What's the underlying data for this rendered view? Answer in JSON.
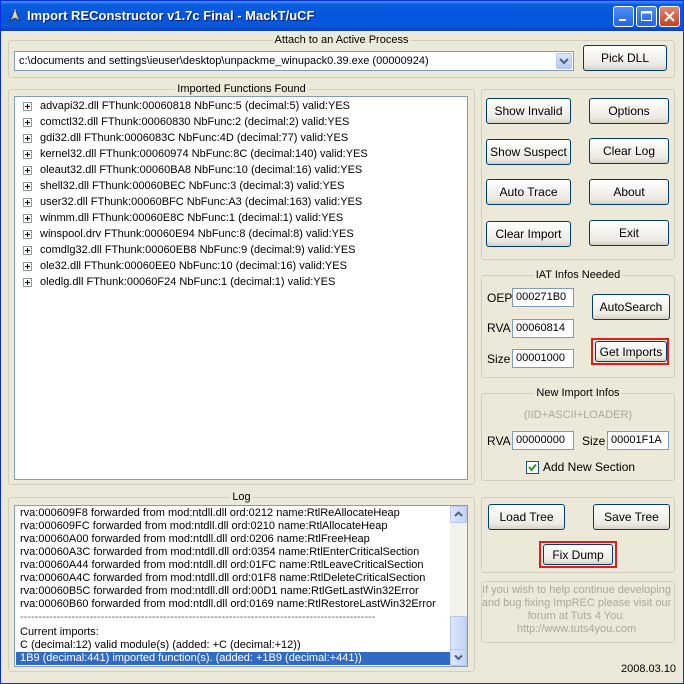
{
  "window": {
    "title": "Import REConstructor v1.7c Final - MackT/uCF"
  },
  "attach": {
    "group_label": "Attach to an Active Process",
    "process": "c:\\documents and settings\\ieuser\\desktop\\unpackme_winupack0.39.exe (00000924)",
    "pick_dll_label": "Pick DLL"
  },
  "imports": {
    "group_label": "Imported Functions Found",
    "items": [
      "advapi32.dll FThunk:00060818 NbFunc:5 (decimal:5) valid:YES",
      "comctl32.dll FThunk:00060830 NbFunc:2 (decimal:2) valid:YES",
      "gdi32.dll FThunk:0006083C NbFunc:4D (decimal:77) valid:YES",
      "kernel32.dll FThunk:00060974 NbFunc:8C (decimal:140) valid:YES",
      "oleaut32.dll FThunk:00060BA8 NbFunc:10 (decimal:16) valid:YES",
      "shell32.dll FThunk:00060BEC NbFunc:3 (decimal:3) valid:YES",
      "user32.dll FThunk:00060BFC NbFunc:A3 (decimal:163) valid:YES",
      "winmm.dll FThunk:00060E8C NbFunc:1 (decimal:1) valid:YES",
      "winspool.drv FThunk:00060E94 NbFunc:8 (decimal:8) valid:YES",
      "comdlg32.dll FThunk:00060EB8 NbFunc:9 (decimal:9) valid:YES",
      "ole32.dll FThunk:00060EE0 NbFunc:10 (decimal:16) valid:YES",
      "oledlg.dll FThunk:00060F24 NbFunc:1 (decimal:1) valid:YES"
    ]
  },
  "buttons": {
    "show_invalid": "Show Invalid",
    "show_suspect": "Show Suspect",
    "auto_trace": "Auto Trace",
    "clear_import": "Clear Import",
    "options": "Options",
    "clear_log": "Clear Log",
    "about": "About",
    "exit": "Exit"
  },
  "iat": {
    "group_label": "IAT Infos Needed",
    "oep_label": "OEP",
    "oep": "000271B0",
    "rva_label": "RVA",
    "rva": "00060814",
    "size_label": "Size",
    "size": "00001000",
    "autosearch_label": "AutoSearch",
    "get_imports_label": "Get Imports"
  },
  "new_import": {
    "group_label": "New Import Infos",
    "hint": "(IID+ASCII+LOADER)",
    "rva_label": "RVA",
    "rva": "00000000",
    "size_label": "Size",
    "size": "00001F1A",
    "add_section_label": "Add New Section",
    "add_section_checked": true
  },
  "log": {
    "group_label": "Log",
    "lines": [
      "rva:000609F8 forwarded from mod:ntdll.dll ord:0212 name:RtlReAllocateHeap",
      "rva:000609FC forwarded from mod:ntdll.dll ord:0210 name:RtlAllocateHeap",
      "rva:00060A00 forwarded from mod:ntdll.dll ord:0206 name:RtlFreeHeap",
      "rva:00060A3C forwarded from mod:ntdll.dll ord:0354 name:RtlEnterCriticalSection",
      "rva:00060A44 forwarded from mod:ntdll.dll ord:01FC name:RtlLeaveCriticalSection",
      "rva:00060A4C forwarded from mod:ntdll.dll ord:01F8 name:RtlDeleteCriticalSection",
      "rva:00060B5C forwarded from mod:ntdll.dll ord:00D1 name:RtlGetLastWin32Error",
      "rva:00060B60 forwarded from mod:ntdll.dll ord:0169 name:RtlRestoreLastWin32Error",
      "-------------------------------------------------------------------------------------------------",
      "Current imports:",
      "C (decimal:12) valid module(s) (added: +C (decimal:+12))",
      "1B9 (decimal:441) imported function(s). (added: +1B9 (decimal:+441))"
    ]
  },
  "tree_buttons": {
    "load_tree": "Load Tree",
    "save_tree": "Save Tree",
    "fix_dump": "Fix Dump"
  },
  "footer": {
    "info": "If you wish to help continue developing and bug fixing ImpREC please visit our forum at Tuts 4 You: http://www.tuts4you.com",
    "date": "2008.03.10"
  },
  "colors": {
    "titlebar": "#0a5ddc",
    "highlight_box": "#e8191c",
    "selection": "#316ac5"
  }
}
